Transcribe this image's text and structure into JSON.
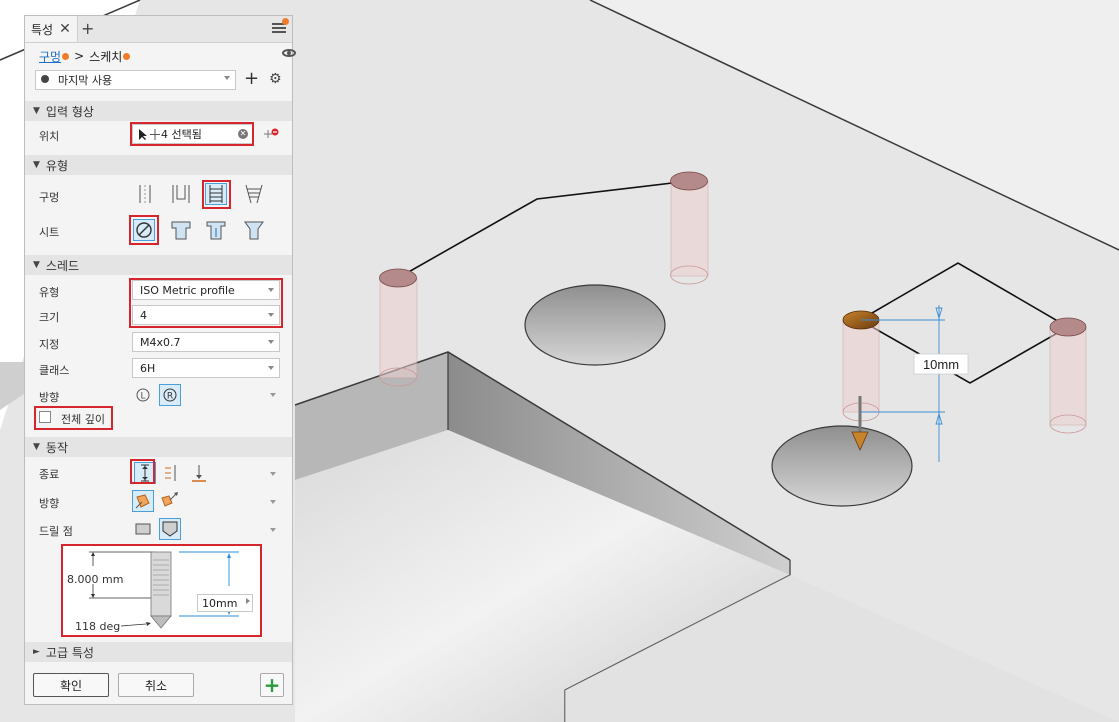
{
  "panel": {
    "tab_label": "특성",
    "breadcrumb": {
      "parent": "구멍",
      "separator": ">",
      "current": "스케치"
    },
    "preset": {
      "value": "마지막 사용"
    },
    "sections": {
      "input_geometry": "입력 형상",
      "type": "유형",
      "thread": "스레드",
      "behavior": "동작",
      "advanced": "고급 특성"
    },
    "position": {
      "label": "위치",
      "value": "4 선택됨"
    },
    "hole_label": "구멍",
    "seat_label": "시트",
    "thread": {
      "type_label": "유형",
      "type_value": "ISO Metric profile",
      "size_label": "크기",
      "size_value": "4",
      "designation_label": "지정",
      "designation_value": "M4x0.7",
      "class_label": "클래스",
      "class_value": "6H",
      "direction_label": "방향",
      "full_depth_label": "전체 깊이"
    },
    "behavior": {
      "termination_label": "종료",
      "direction_label": "방향",
      "drill_point_label": "드릴 점"
    },
    "preview": {
      "hole_depth": "8.000 mm",
      "thread_depth": "10mm",
      "drill_angle": "118 deg"
    },
    "buttons": {
      "ok": "확인",
      "cancel": "취소"
    }
  },
  "viewport": {
    "dimension_label": "10mm"
  },
  "colors": {
    "accent_blue": "#1b6ec2",
    "highlight_red": "#d4262c",
    "notification_orange": "#f07b2a",
    "add_green": "#2a9d3a"
  }
}
